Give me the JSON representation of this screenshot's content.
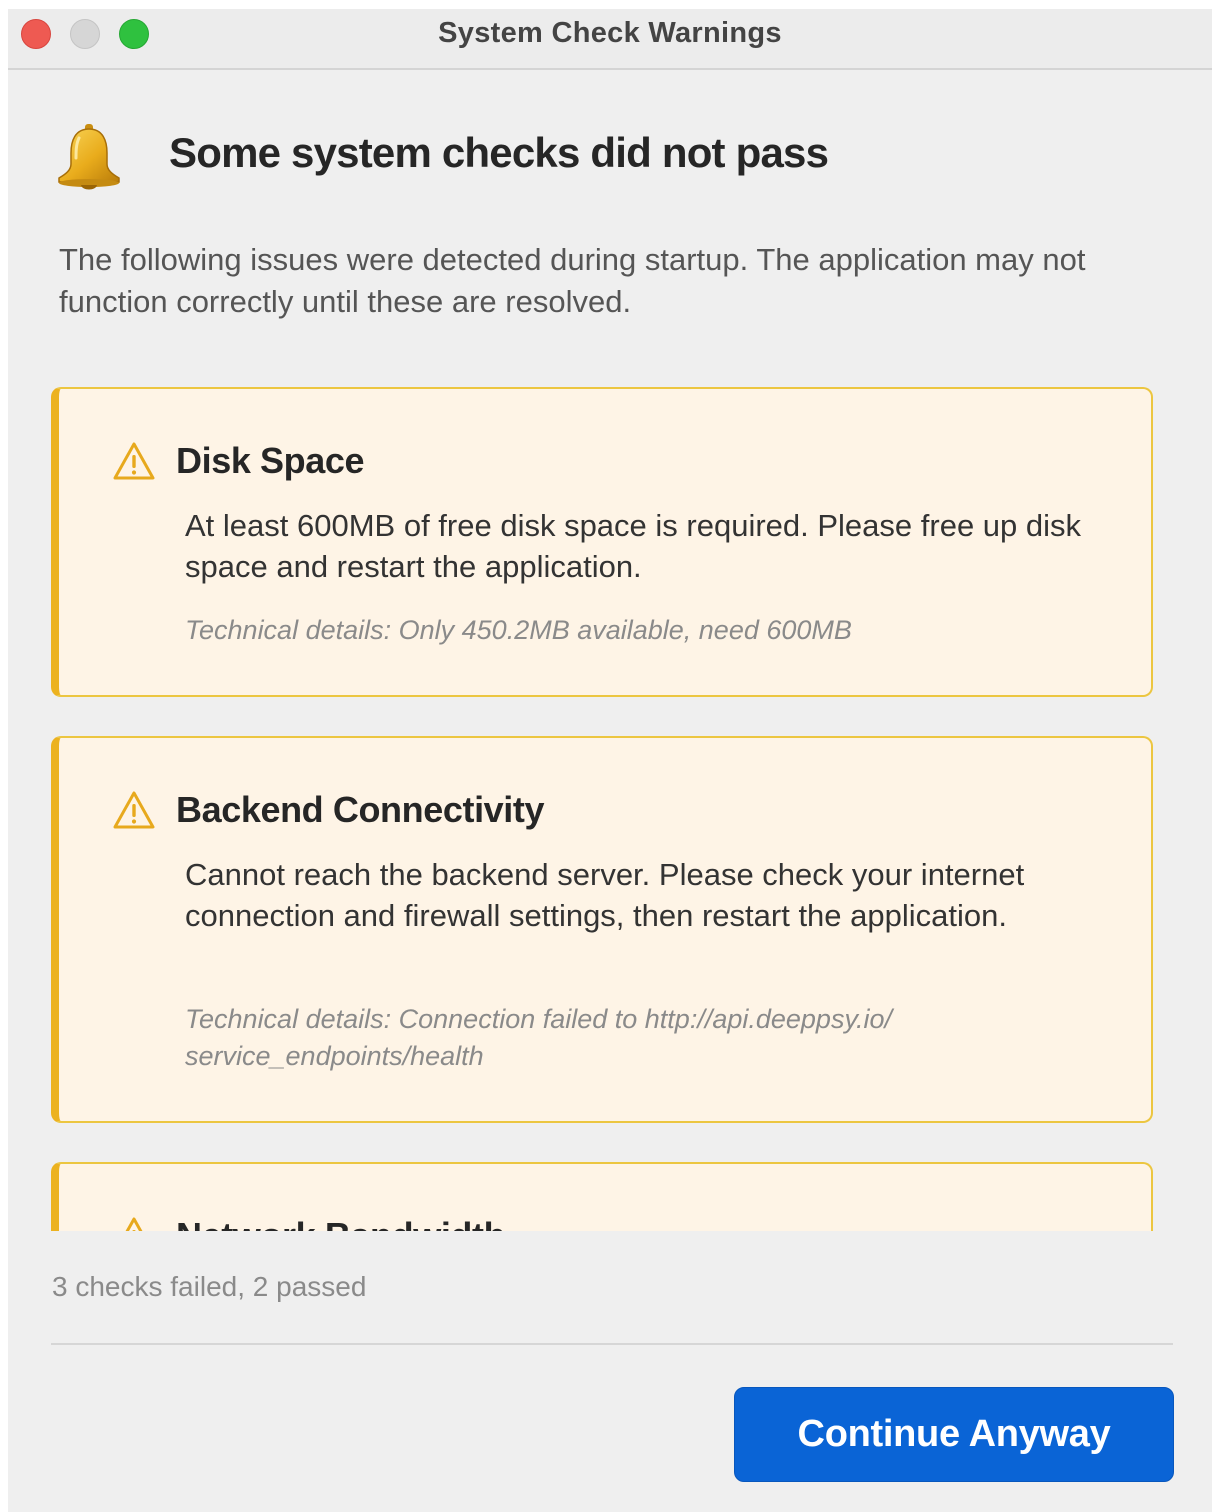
{
  "window": {
    "title": "System Check Warnings",
    "controls": {
      "close": "close",
      "minimize": "minimize",
      "zoom": "zoom"
    }
  },
  "header": {
    "icon": "bell-icon",
    "title": "Some system checks did not pass",
    "description": "The following issues were detected during startup. The application may not function correctly until these are resolved."
  },
  "checks": [
    {
      "icon": "warning-icon",
      "title": "Disk Space",
      "message": "At least 600MB of free disk space is required. Please free up disk space and restart the application.",
      "details": "Technical details: Only 450.2MB available, need 600MB"
    },
    {
      "icon": "warning-icon",
      "title": "Backend Connectivity",
      "message": "Cannot reach the backend server. Please check your internet connection and firewall settings, then restart the application.",
      "details": "Technical details: Connection failed to http://api.deeppsy.io/ service_endpoints/health"
    },
    {
      "icon": "warning-icon",
      "title": "Network Bandwidth"
    }
  ],
  "footer": {
    "summary": "3 checks failed, 2 passed",
    "continue_label": "Continue Anyway"
  },
  "colors": {
    "accent": "#0a64d6",
    "warning_border": "#ecb21f",
    "card_background": "#fef4e6",
    "close": "#ee5a52",
    "minimize": "#d6d6d6",
    "zoom": "#2fc13f"
  }
}
